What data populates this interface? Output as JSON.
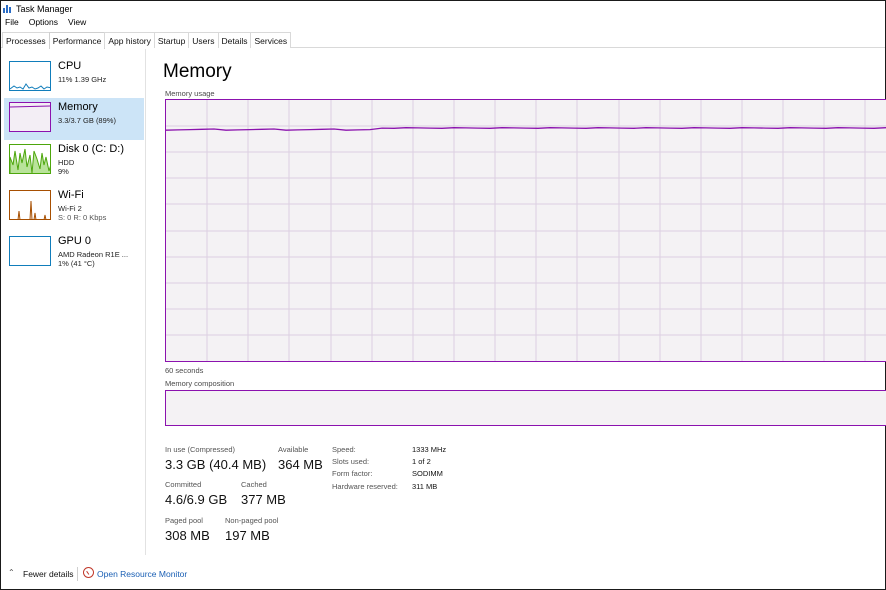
{
  "window": {
    "title": "Task Manager"
  },
  "menu": [
    "File",
    "Options",
    "View"
  ],
  "tabs": [
    "Processes",
    "Performance",
    "App history",
    "Startup",
    "Users",
    "Details",
    "Services"
  ],
  "active_tab": "Performance",
  "sidebar": {
    "items": [
      {
        "title": "CPU",
        "lines": [
          "11% 1.39 GHz"
        ],
        "color": "#117dbb"
      },
      {
        "title": "Memory",
        "lines": [
          "3.3/3.7 GB (89%)"
        ],
        "color": "#8b12ae",
        "selected": true
      },
      {
        "title": "Disk 0 (C: D:)",
        "lines": [
          "HDD",
          "9%"
        ],
        "color": "#4da60c"
      },
      {
        "title": "Wi-Fi",
        "lines": [
          "Wi-Fi 2",
          "S: 0 R: 0 Kbps"
        ],
        "color": "#a74f01"
      },
      {
        "title": "GPU 0",
        "lines": [
          "AMD Radeon R1E ...",
          "1% (41 °C)"
        ],
        "color": "#117dbb"
      }
    ]
  },
  "main": {
    "title": "Memory",
    "usage_label": "Memory usage",
    "seconds_label": "60 seconds",
    "composition_label": "Memory composition",
    "usage_level_percent": 89
  },
  "stats": {
    "in_use_label": "In use (Compressed)",
    "in_use_value": "3.3 GB (40.4 MB)",
    "available_label": "Available",
    "available_value": "364 MB",
    "committed_label": "Committed",
    "committed_value": "4.6/6.9 GB",
    "cached_label": "Cached",
    "cached_value": "377 MB",
    "paged_label": "Paged pool",
    "paged_value": "308 MB",
    "nonpaged_label": "Non-paged pool",
    "nonpaged_value": "197 MB"
  },
  "details": [
    {
      "key": "Speed:",
      "value": "1333 MHz"
    },
    {
      "key": "Slots used:",
      "value": "1 of 2"
    },
    {
      "key": "Form factor:",
      "value": "SODIMM"
    },
    {
      "key": "Hardware reserved:",
      "value": "311 MB"
    }
  ],
  "footer": {
    "fewer_details": "Fewer details",
    "open_resource_monitor": "Open Resource Monitor"
  },
  "colors": {
    "memory": "#8b12ae",
    "selected_bg": "#cce4f7",
    "link": "#1a5fb4"
  }
}
